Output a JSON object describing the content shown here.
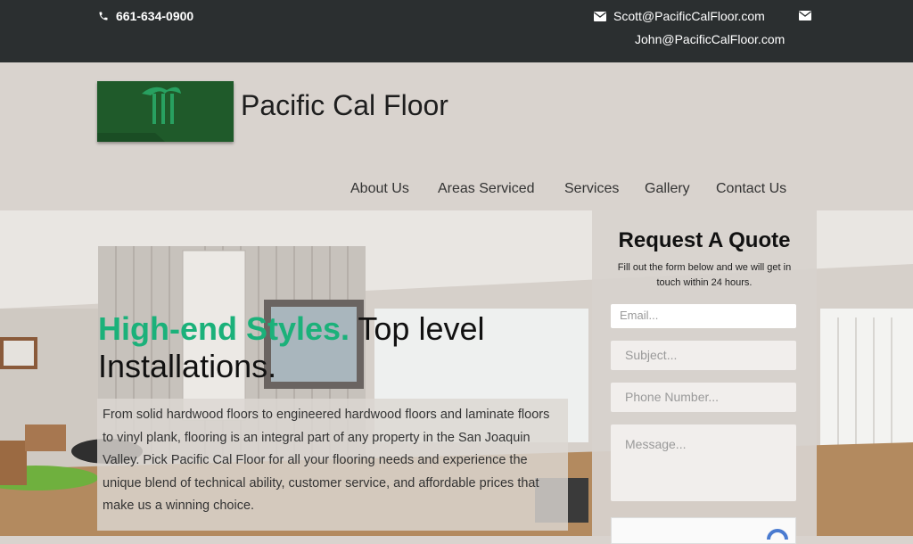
{
  "topbar": {
    "phone": "661-634-0900",
    "email_1": "Scott@PacificCalFloor.com",
    "email_2": "John@PacificCalFloor.com"
  },
  "header": {
    "site_title": "Pacific Cal Floor",
    "nav": [
      "About Us",
      "Areas Serviced",
      "Services",
      "Gallery",
      "Contact Us"
    ]
  },
  "hero": {
    "headline_accent": "High-end Styles.",
    "headline_rest": " Top level Installations.",
    "description": "From solid hardwood floors to engineered hardwood floors and laminate floors to vinyl plank, flooring is an integral part of any property in the San Joaquin Valley. Pick Pacific Cal Floor for all your flooring needs and experience the unique blend of technical ability, customer service, and affordable prices that make us a winning choice."
  },
  "quote": {
    "title": "Request A Quote",
    "subtitle": "Fill out the form below and we will get in touch within 24 hours.",
    "email_placeholder": "Email...",
    "subject_placeholder": "Subject...",
    "phone_placeholder": "Phone Number...",
    "message_placeholder": "Message..."
  },
  "colors": {
    "topbar": "#2b2f30",
    "header_bg": "#d9d3ce",
    "accent": "#1bb17a",
    "logo_green": "#1f5a2a"
  },
  "icons": [
    "phone-icon",
    "envelope-icon",
    "palm-tree-logo"
  ]
}
